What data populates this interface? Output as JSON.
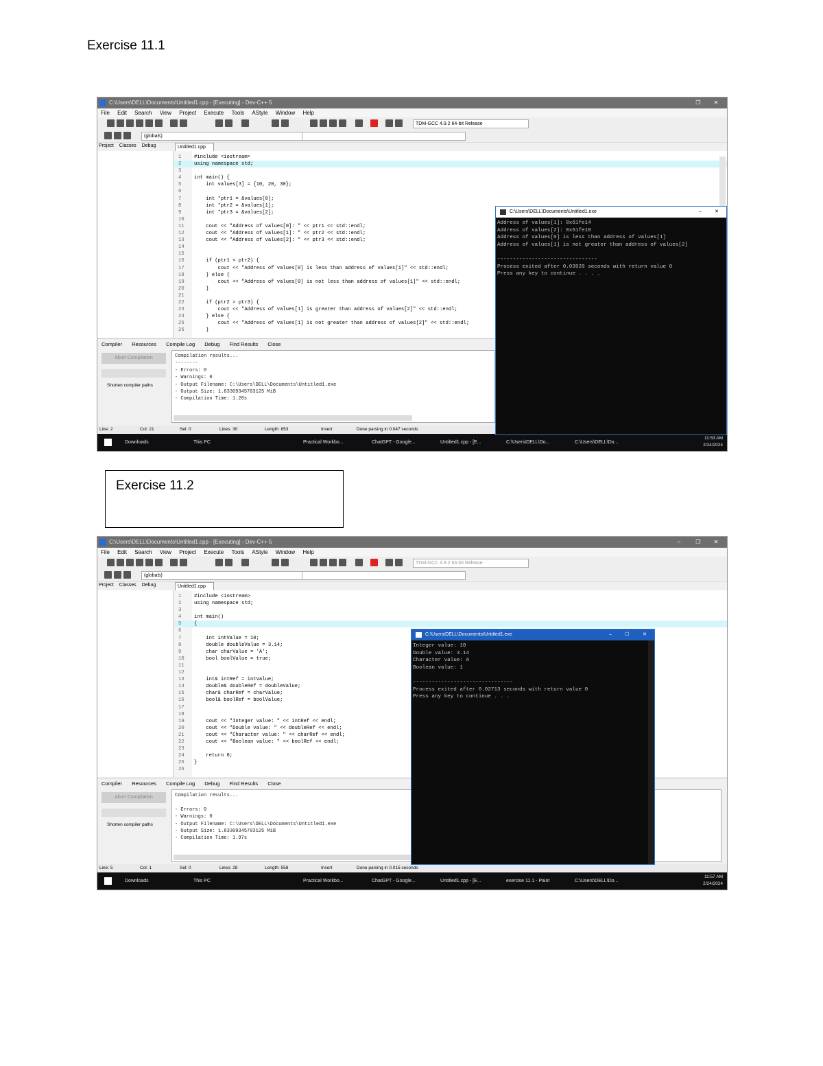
{
  "headings": {
    "ex1": "Exercise 11.1",
    "ex2": "Exercise 11.2"
  },
  "ide1": {
    "title": "C:\\Users\\DELL\\Documents\\Untitled1.cpp - [Executing] - Dev-C++ 5",
    "menu": [
      "File",
      "Edit",
      "Search",
      "View",
      "Project",
      "Execute",
      "Tools",
      "AStyle",
      "Window",
      "Help"
    ],
    "compiler_combo": "TDM-GCC 4.9.2 64-bit Release",
    "scope_combo": "(globals)",
    "left_tabs": [
      "Project",
      "Classes",
      "Debug"
    ],
    "file_tab": "Untitled1.cpp",
    "code": [
      {
        "n": "1",
        "t": "#include <iostream>"
      },
      {
        "n": "2",
        "t": "using namespace std;"
      },
      {
        "n": "3",
        "t": ""
      },
      {
        "n": "4",
        "t": "int main() {"
      },
      {
        "n": "5",
        "t": "    int values[3] = {10, 20, 30};"
      },
      {
        "n": "6",
        "t": ""
      },
      {
        "n": "7",
        "t": "    int *ptr1 = &values[0];"
      },
      {
        "n": "8",
        "t": "    int *ptr2 = &values[1];"
      },
      {
        "n": "9",
        "t": "    int *ptr3 = &values[2];"
      },
      {
        "n": "10",
        "t": ""
      },
      {
        "n": "11",
        "t": "    cout << \"Address of values[0]: \" << ptr1 << std::endl;"
      },
      {
        "n": "12",
        "t": "    cout << \"Address of values[1]: \" << ptr2 << std::endl;"
      },
      {
        "n": "13",
        "t": "    cout << \"Address of values[2]: \" << ptr3 << std::endl;"
      },
      {
        "n": "14",
        "t": ""
      },
      {
        "n": "15",
        "t": ""
      },
      {
        "n": "16",
        "t": "    if (ptr1 < ptr2) {"
      },
      {
        "n": "17",
        "t": "        cout << \"Address of values[0] is less than address of values[1]\" << std::endl;"
      },
      {
        "n": "18",
        "t": "    } else {"
      },
      {
        "n": "19",
        "t": "        cout << \"Address of values[0] is not less than address of values[1]\" << std::endl;"
      },
      {
        "n": "20",
        "t": "    }"
      },
      {
        "n": "21",
        "t": ""
      },
      {
        "n": "22",
        "t": "    if (ptr2 > ptr3) {"
      },
      {
        "n": "23",
        "t": "        cout << \"Address of values[1] is greater than address of values[2]\" << std::endl;"
      },
      {
        "n": "24",
        "t": "    } else {"
      },
      {
        "n": "25",
        "t": "        cout << \"Address of values[1] is not greater than address of values[2]\" << std::endl;"
      },
      {
        "n": "26",
        "t": "    }"
      }
    ],
    "bottom_tabs": [
      "Compiler",
      "Resources",
      "Compile Log",
      "Debug",
      "Find Results",
      "Close"
    ],
    "abort_label": "Abort Compilation",
    "shorten_label": "Shorten compiler paths",
    "compile_output": "Compilation results...\n--------\n- Errors: 0\n- Warnings: 0\n- Output Filename: C:\\Users\\DELL\\Documents\\Untitled1.exe\n- Output Size: 1.83309345703125 MiB\n- Compilation Time: 1.20s",
    "status": {
      "line": "Line: 2",
      "col": "Col: 21",
      "sel": "Sel: 0",
      "lines": "Lines: 30",
      "length": "Length: 853",
      "mode": "Insert",
      "done": "Done parsing in 0.047 seconds"
    },
    "console": {
      "title": "C:\\Users\\DELL\\Documents\\Untitled1.exe",
      "output": "Address of values[1]: 0x61fe14\nAddress of values[2]: 0x61fe18\nAddress of values[0] is less than address of values[1]\nAddress of values[1] is not greater than address of values[2]\n\n--------------------------------\nProcess exited after 0.03920 seconds with return value 0\nPress any key to continue . . . _"
    },
    "taskbar": [
      "Downloads",
      "This PC",
      "Practical Workbo...",
      "ChatGPT - Google...",
      "Untitled1.cpp - [E...",
      "C:\\Users\\DELL\\Do...",
      "C:\\Users\\DELL\\Do..."
    ],
    "clock": {
      "time": "11:53 AM",
      "date": "2/24/2024"
    }
  },
  "ide2": {
    "title": "C:\\Users\\DELL\\Documents\\Untitled1.cpp - [Executing] - Dev-C++ 5",
    "menu": [
      "File",
      "Edit",
      "Search",
      "View",
      "Project",
      "Execute",
      "Tools",
      "AStyle",
      "Window",
      "Help"
    ],
    "compiler_combo": "TDM-GCC 4.9.2 64-bit Release",
    "scope_combo": "(globals)",
    "left_tabs": [
      "Project",
      "Classes",
      "Debug"
    ],
    "file_tab": "Untitled1.cpp",
    "code": [
      {
        "n": "1",
        "t": "#include <iostream>"
      },
      {
        "n": "2",
        "t": "using namespace std;"
      },
      {
        "n": "3",
        "t": ""
      },
      {
        "n": "4",
        "t": "int main()"
      },
      {
        "n": "5",
        "t": "{"
      },
      {
        "n": "6",
        "t": ""
      },
      {
        "n": "7",
        "t": "    int intValue = 10;"
      },
      {
        "n": "8",
        "t": "    double doubleValue = 3.14;"
      },
      {
        "n": "9",
        "t": "    char charValue = 'A';"
      },
      {
        "n": "10",
        "t": "    bool boolValue = true;"
      },
      {
        "n": "11",
        "t": ""
      },
      {
        "n": "12",
        "t": ""
      },
      {
        "n": "13",
        "t": "    int& intRef = intValue;"
      },
      {
        "n": "14",
        "t": "    double& doubleRef = doubleValue;"
      },
      {
        "n": "15",
        "t": "    char& charRef = charValue;"
      },
      {
        "n": "16",
        "t": "    bool& boolRef = boolValue;"
      },
      {
        "n": "17",
        "t": ""
      },
      {
        "n": "18",
        "t": ""
      },
      {
        "n": "19",
        "t": "    cout << \"Integer value: \" << intRef << endl;"
      },
      {
        "n": "20",
        "t": "    cout << \"Double value: \" << doubleRef << endl;"
      },
      {
        "n": "21",
        "t": "    cout << \"Character value: \" << charRef << endl;"
      },
      {
        "n": "22",
        "t": "    cout << \"Boolean value: \" << boolRef << endl;"
      },
      {
        "n": "23",
        "t": ""
      },
      {
        "n": "24",
        "t": "    return 0;"
      },
      {
        "n": "25",
        "t": "}"
      },
      {
        "n": "26",
        "t": ""
      }
    ],
    "bottom_tabs": [
      "Compiler",
      "Resources",
      "Compile Log",
      "Debug",
      "Find Results",
      "Close"
    ],
    "abort_label": "Abort Compilation",
    "shorten_label": "Shorten compiler paths",
    "compile_output": "Compilation results...\n\n- Errors: 0\n- Warnings: 0\n- Output Filename: C:\\Users\\DELL\\Documents\\Untitled1.exe\n- Output Size: 1.83309345703125 MiB\n- Compilation Time: 1.97s",
    "status": {
      "line": "Line: 5",
      "col": "Col: 1",
      "sel": "Sel: 0",
      "lines": "Lines: 28",
      "length": "Length: 558",
      "mode": "Insert",
      "done": "Done parsing in 0.015 seconds"
    },
    "console": {
      "title": "C:\\Users\\DELL\\Documents\\Untitled1.exe",
      "output": "Integer value: 10\nDouble value: 3.14\nCharacter value: A\nBoolean value: 1\n\n--------------------------------\nProcess exited after 0.02713 seconds with return value 0\nPress any key to continue . . ."
    },
    "taskbar": [
      "Downloads",
      "This PC",
      "Practical Workbo...",
      "ChatGPT - Google...",
      "Untitled1.cpp - [E...",
      "exercise 11.1 - Paint",
      "C:\\Users\\DELL\\Do..."
    ],
    "clock": {
      "time": "11:57 AM",
      "date": "2/24/2024"
    }
  }
}
